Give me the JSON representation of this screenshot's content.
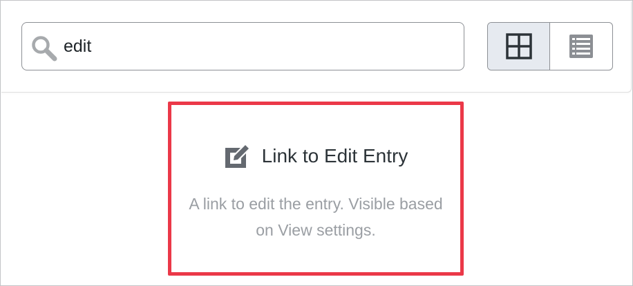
{
  "search": {
    "value": "edit",
    "icon": "search-icon"
  },
  "view_toggle": {
    "options": [
      {
        "name": "grid",
        "icon": "grid-view-icon",
        "selected": true
      },
      {
        "name": "list",
        "icon": "list-view-icon",
        "selected": false
      }
    ]
  },
  "result_card": {
    "icon": "edit-icon",
    "title": "Link to Edit Entry",
    "description": "A link to edit the entry. Visible based on View settings.",
    "highlight_color": "#eb3848"
  }
}
